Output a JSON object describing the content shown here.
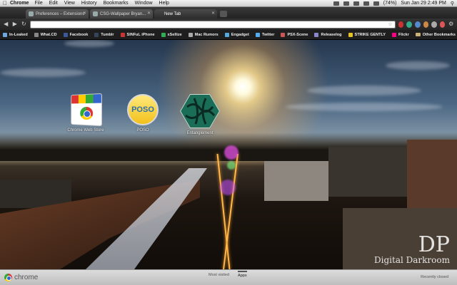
{
  "menubar": {
    "app": "Chrome",
    "menus": [
      "File",
      "Edit",
      "View",
      "History",
      "Bookmarks",
      "Window",
      "Help"
    ],
    "battery": "(74%)",
    "clock": "Sun Jan 29  2:49 PM"
  },
  "tabs": [
    {
      "label": "Preferences – Extensions"
    },
    {
      "label": "CSG-Wallpaper Bryan..."
    },
    {
      "label": "New Tab"
    }
  ],
  "omnibox": {
    "value": "",
    "placeholder": ""
  },
  "bookmarks": [
    {
      "label": "In-Leaked",
      "color": "#6fa8dc"
    },
    {
      "label": "What.CD",
      "color": "#888888"
    },
    {
      "label": "Facebook",
      "color": "#3b5998"
    },
    {
      "label": "Tumblr",
      "color": "#35465c"
    },
    {
      "label": "SINFuL iPhone",
      "color": "#cc3333"
    },
    {
      "label": "xSellize",
      "color": "#33aa55"
    },
    {
      "label": "Mac Rumors",
      "color": "#aaaaaa"
    },
    {
      "label": "Engadget",
      "color": "#55aadd"
    },
    {
      "label": "Twitter",
      "color": "#55acee"
    },
    {
      "label": "PSX-Scene",
      "color": "#cc5555"
    },
    {
      "label": "Releaselog",
      "color": "#8888cc"
    },
    {
      "label": "STRIKE GENTLY",
      "color": "#e6c229"
    },
    {
      "label": "Flickr",
      "color": "#ff0084"
    }
  ],
  "other_bookmarks": "Other Bookmarks",
  "apps": [
    {
      "label": "Chrome Web Store"
    },
    {
      "label": "POSO",
      "logo_text": "POSO"
    },
    {
      "label": "Entanglement"
    }
  ],
  "watermark": {
    "monogram": "DP",
    "text": "Digital Darkroom"
  },
  "footer": {
    "logo": "chrome",
    "nav": [
      "Most visited",
      "Apps"
    ],
    "recent": "Recently closed"
  }
}
